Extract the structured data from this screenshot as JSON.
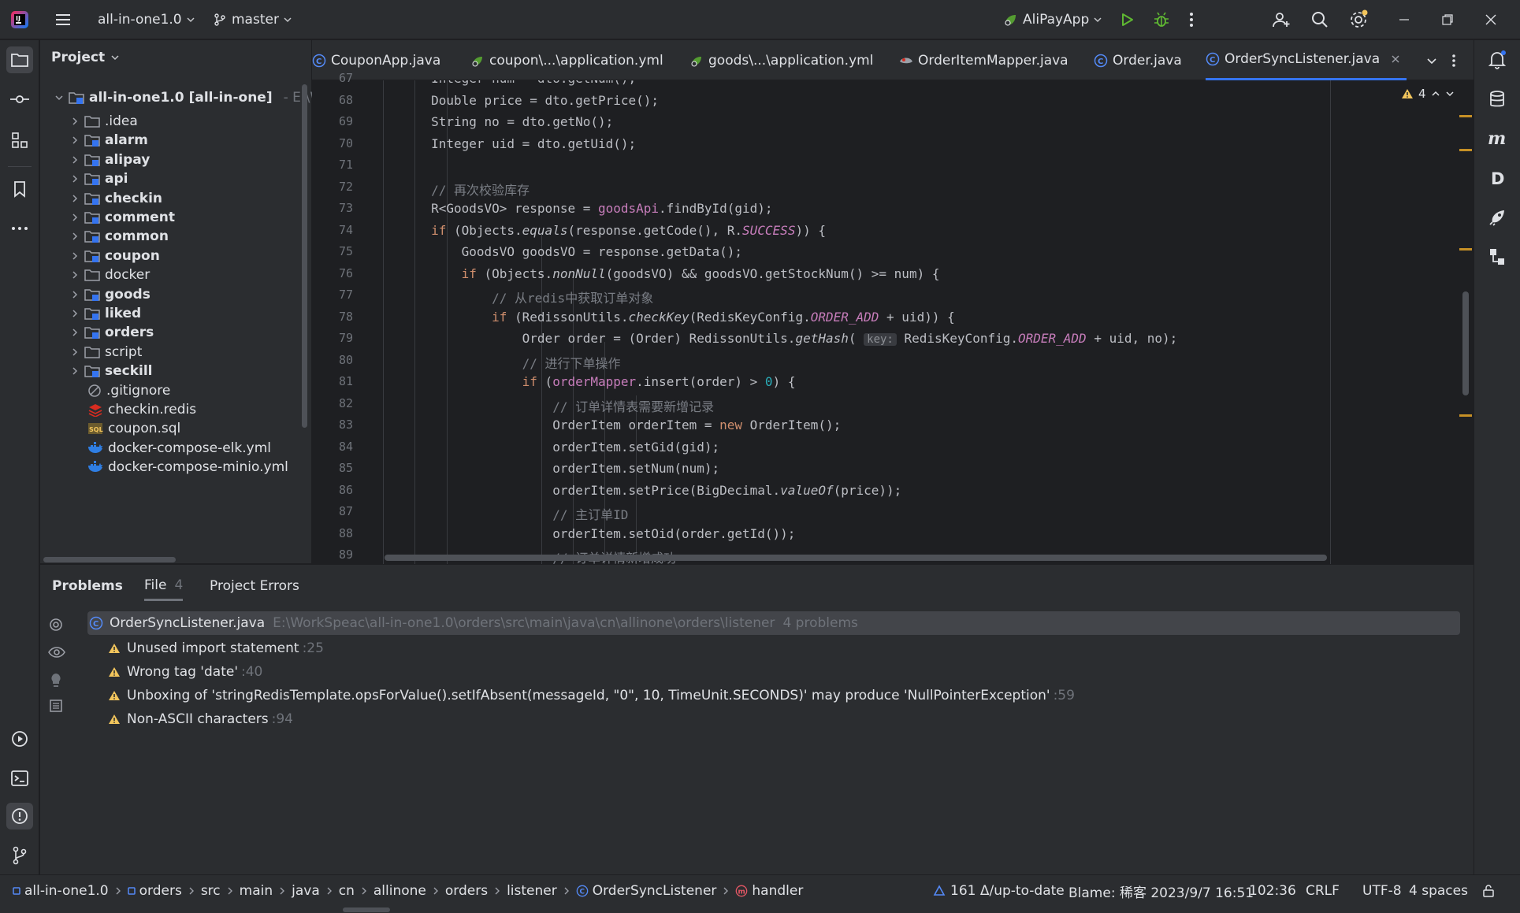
{
  "titlebar": {
    "project": "all-in-one1.0",
    "branch": "master",
    "run_config": "AliPayApp"
  },
  "project_panel": {
    "title": "Project",
    "root": {
      "name": "all-in-one1.0",
      "module": "[all-in-one]",
      "path": "- E:\\Wor"
    },
    "items": [
      {
        "label": ".idea",
        "type": "folder",
        "bold": false
      },
      {
        "label": "alarm",
        "type": "module",
        "bold": true
      },
      {
        "label": "alipay",
        "type": "module",
        "bold": true
      },
      {
        "label": "api",
        "type": "module",
        "bold": true
      },
      {
        "label": "checkin",
        "type": "module",
        "bold": true
      },
      {
        "label": "comment",
        "type": "module",
        "bold": true
      },
      {
        "label": "common",
        "type": "module",
        "bold": true
      },
      {
        "label": "coupon",
        "type": "module",
        "bold": true
      },
      {
        "label": "docker",
        "type": "folder",
        "bold": false
      },
      {
        "label": "goods",
        "type": "module",
        "bold": true
      },
      {
        "label": "liked",
        "type": "module",
        "bold": true
      },
      {
        "label": "orders",
        "type": "module",
        "bold": true
      },
      {
        "label": "script",
        "type": "folder",
        "bold": false
      },
      {
        "label": "seckill",
        "type": "module",
        "bold": true
      },
      {
        "label": ".gitignore",
        "type": "ignore",
        "bold": false
      },
      {
        "label": "checkin.redis",
        "type": "redis",
        "bold": false
      },
      {
        "label": "coupon.sql",
        "type": "sql",
        "bold": false
      },
      {
        "label": "docker-compose-elk.yml",
        "type": "docker",
        "bold": false
      },
      {
        "label": "docker-compose-minio.yml",
        "type": "docker",
        "bold": false
      }
    ]
  },
  "tabs": [
    {
      "label": "CouponApp.java",
      "icon": "java-class-icon",
      "active": false
    },
    {
      "label": "coupon\\...\\application.yml",
      "icon": "spring-yml-icon",
      "active": false
    },
    {
      "label": "goods\\...\\application.yml",
      "icon": "spring-yml-icon",
      "active": false
    },
    {
      "label": "OrderItemMapper.java",
      "icon": "mapper-icon",
      "active": false
    },
    {
      "label": "Order.java",
      "icon": "java-class-icon",
      "active": false
    },
    {
      "label": "OrderSyncListener.java",
      "icon": "java-class-icon",
      "active": true
    }
  ],
  "editor": {
    "warning_count": "4",
    "line_numbers": [
      "67",
      "68",
      "69",
      "70",
      "71",
      "72",
      "73",
      "74",
      "75",
      "76",
      "77",
      "78",
      "79",
      "80",
      "81",
      "82",
      "83",
      "84",
      "85",
      "86",
      "87",
      "88",
      "89"
    ],
    "lines": [
      "        Integer num = dto.getNum();",
      "        Double price = dto.getPrice();",
      "        String no = dto.getNo();",
      "        Integer uid = dto.getUid();",
      "",
      "        // 再次校验库存",
      "        R<GoodsVO> response = goodsApi.findById(gid);",
      "        if (Objects.equals(response.getCode(), R.SUCCESS)) {",
      "            GoodsVO goodsVO = response.getData();",
      "            if (Objects.nonNull(goodsVO) && goodsVO.getStockNum() >= num) {",
      "                // 从redis中获取订单对象",
      "                if (RedissonUtils.checkKey(RedisKeyConfig.ORDER_ADD + uid)) {",
      "                    Order order = (Order) RedissonUtils.getHash( key: RedisKeyConfig.ORDER_ADD + uid, no);",
      "                    // 进行下单操作",
      "                    if (orderMapper.insert(order) > 0) {",
      "                        // 订单详情表需要新增记录",
      "                        OrderItem orderItem = new OrderItem();",
      "                        orderItem.setGid(gid);",
      "                        orderItem.setNum(num);",
      "                        orderItem.setPrice(BigDecimal.valueOf(price));",
      "                        // 主订单ID",
      "                        orderItem.setOid(order.getId());",
      "                        // 订单详情新增成功"
    ]
  },
  "problems": {
    "tabs": [
      {
        "label": "Problems"
      },
      {
        "label": "File",
        "count": "4"
      },
      {
        "label": "Project Errors"
      }
    ],
    "file": {
      "name": "OrderSyncListener.java",
      "path": "E:\\WorkSpeac\\all-in-one1.0\\orders\\src\\main\\java\\cn\\allinone\\orders\\listener",
      "summary": "4 problems"
    },
    "items": [
      {
        "text": "Unused import statement",
        "line": ":25"
      },
      {
        "text": "Wrong tag 'date'",
        "line": ":40"
      },
      {
        "text": "Unboxing of 'stringRedisTemplate.opsForValue().setIfAbsent(messageId, \"0\", 10, TimeUnit.SECONDS)' may produce 'NullPointerException'",
        "line": ":59"
      },
      {
        "text": "Non-ASCII characters",
        "line": ":94"
      }
    ]
  },
  "statusbar": {
    "breadcrumbs": [
      "all-in-one1.0",
      "orders",
      "src",
      "main",
      "java",
      "cn",
      "allinone",
      "orders",
      "listener",
      "OrderSyncListener",
      "handler"
    ],
    "vcs": "161 Δ/up-to-date",
    "blame": "Blame: 稀客 2023/9/7 16:51",
    "position": "102:36",
    "line_sep": "CRLF",
    "encoding": "UTF-8",
    "indent": "4 spaces"
  },
  "colors": {
    "accent": "#3574f0",
    "warning": "#f2c55c",
    "keyword": "#cf8e6d",
    "comment": "#7a7e85",
    "field": "#c77dbb",
    "number": "#2aacb8"
  }
}
